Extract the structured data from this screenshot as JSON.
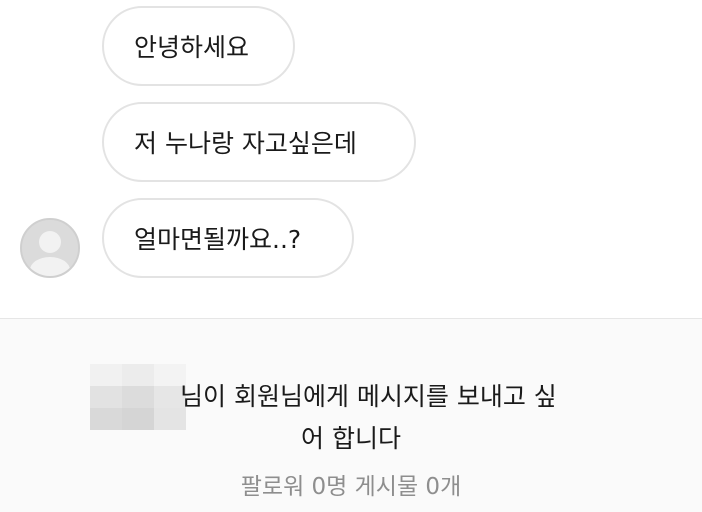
{
  "messages": [
    {
      "text": "안녕하세요"
    },
    {
      "text": "저 누나랑 자고싶은데"
    },
    {
      "text": "얼마면될까요..?"
    }
  ],
  "request": {
    "line1": "님이 회원님에게 메시지를 보내고 싶",
    "line2": "어 합니다",
    "stats": "팔로워 0명 게시물 0개"
  },
  "colors": {
    "bubble_border": "#e3e3e3",
    "panel_background": "#fafafa",
    "secondary_text": "#8e8e8e"
  }
}
